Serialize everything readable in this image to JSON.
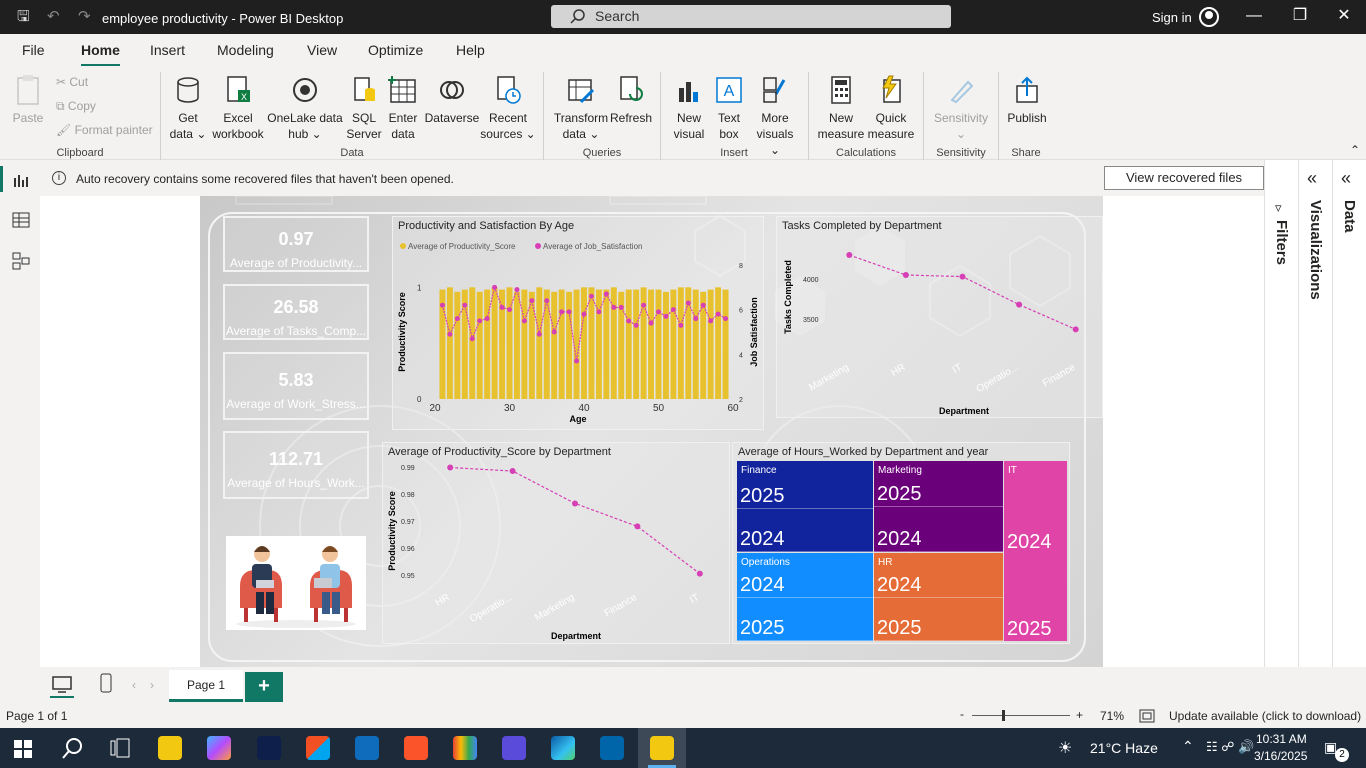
{
  "window": {
    "title": "employee productivity - Power BI Desktop",
    "search_placeholder": "Search",
    "sign_in": "Sign in"
  },
  "menu": [
    "File",
    "Home",
    "Insert",
    "Modeling",
    "View",
    "Optimize",
    "Help"
  ],
  "ribbon": {
    "clipboard": {
      "paste": "Paste",
      "cut": "Cut",
      "copy": "Copy",
      "format_painter": "Format painter",
      "group": "Clipboard"
    },
    "data": {
      "get_data": [
        "Get",
        "data ⌄"
      ],
      "excel": [
        "Excel",
        "workbook"
      ],
      "onelake": [
        "OneLake data",
        "hub ⌄"
      ],
      "sql": [
        "SQL",
        "Server"
      ],
      "enter": [
        "Enter",
        "data"
      ],
      "dataverse": [
        "Dataverse"
      ],
      "recent": [
        "Recent",
        "sources ⌄"
      ],
      "group": "Data"
    },
    "queries": {
      "transform": [
        "Transform",
        "data ⌄"
      ],
      "refresh": [
        "Refresh"
      ],
      "group": "Queries"
    },
    "insert": {
      "new_visual": [
        "New",
        "visual"
      ],
      "text_box": [
        "Text",
        "box"
      ],
      "more_visuals": [
        "More",
        "visuals ⌄"
      ],
      "group": "Insert"
    },
    "calculations": {
      "new_measure": [
        "New",
        "measure"
      ],
      "quick_measure": [
        "Quick",
        "measure"
      ],
      "group": "Calculations"
    },
    "sensitivity": {
      "label": [
        "Sensitivity",
        "⌄"
      ],
      "group": "Sensitivity"
    },
    "share": {
      "publish": [
        "Publish"
      ],
      "group": "Share"
    }
  },
  "infobar": {
    "message": "Auto recovery contains some recovered files that haven't been opened.",
    "button": "View recovered files"
  },
  "panes": {
    "filters": "Filters",
    "visualizations": "Visualizations",
    "data": "Data"
  },
  "cards": [
    {
      "value": "0.97",
      "label": "Average of Productivity..."
    },
    {
      "value": "26.58",
      "label": "Average of Tasks_Comp..."
    },
    {
      "value": "5.83",
      "label": "Average of Work_Stress..."
    },
    {
      "value": "112.71",
      "label": "Average of Hours_Work..."
    }
  ],
  "chart_data": [
    {
      "type": "bar",
      "title": "Productivity and Satisfaction By Age",
      "xlabel": "Age",
      "ylabel": "Productivity Score",
      "y2label": "Job Satisfaction",
      "x": [
        21,
        22,
        23,
        24,
        25,
        26,
        27,
        28,
        29,
        30,
        31,
        32,
        33,
        34,
        35,
        36,
        37,
        38,
        39,
        40,
        41,
        42,
        43,
        44,
        45,
        46,
        47,
        48,
        49,
        50,
        51,
        52,
        53,
        54,
        55,
        56,
        57,
        58,
        59
      ],
      "series": [
        {
          "name": "Average of Productivity_Score",
          "color": "#e8c22e",
          "values": [
            0.98,
            1.0,
            0.96,
            0.98,
            1.0,
            0.96,
            0.98,
            1.0,
            0.98,
            1.0,
            0.96,
            0.98,
            0.96,
            1.0,
            0.98,
            0.96,
            0.98,
            0.96,
            0.98,
            1.0,
            1.0,
            0.98,
            0.98,
            1.0,
            0.96,
            0.98,
            0.98,
            1.0,
            0.98,
            0.98,
            0.96,
            0.98,
            1.0,
            1.0,
            0.98,
            0.96,
            0.98,
            1.0,
            0.98
          ]
        },
        {
          "name": "Average of Job_Satisfaction",
          "color": "#d63fb5",
          "values": [
            6.2,
            4.9,
            5.6,
            6.2,
            4.7,
            5.5,
            5.6,
            7.0,
            6.1,
            6.0,
            6.9,
            5.5,
            6.4,
            4.9,
            6.4,
            5.0,
            5.9,
            5.9,
            3.7,
            5.8,
            6.6,
            5.9,
            6.7,
            6.1,
            6.1,
            5.5,
            5.3,
            6.2,
            5.4,
            5.9,
            5.7,
            6.0,
            5.3,
            6.3,
            5.6,
            6.2,
            5.5,
            5.8,
            5.6
          ]
        }
      ],
      "xticks": [
        "20",
        "30",
        "40",
        "50",
        "60"
      ],
      "yticks": [
        "0",
        "1"
      ],
      "y2ticks": [
        "2",
        "4",
        "6",
        "8"
      ]
    },
    {
      "type": "line",
      "title": "Tasks Completed by Department",
      "xlabel": "Department",
      "ylabel": "Tasks Completed",
      "categories": [
        "Marketing",
        "HR",
        "IT",
        "Operatio...",
        "Finance"
      ],
      "values": [
        4300,
        4050,
        4030,
        3680,
        3370
      ],
      "yticks": [
        "4000",
        "3500"
      ],
      "ylim": [
        3300,
        4400
      ],
      "color": "#d63fb5"
    },
    {
      "type": "line",
      "title": "Average of Productivity_Score by Department",
      "xlabel": "Department",
      "ylabel": "Productivity Score",
      "categories": [
        "HR",
        "Operatio...",
        "Marketing",
        "Finance",
        "IT"
      ],
      "values": [
        0.9898,
        0.9885,
        0.9765,
        0.968,
        0.9505
      ],
      "yticks": [
        "0.99",
        "0.98",
        "0.97",
        "0.96",
        "0.95"
      ],
      "ylim": [
        0.95,
        0.99
      ],
      "color": "#d63fb5"
    }
  ],
  "treemap": {
    "title": "Average of Hours_Worked by Department and year",
    "cells": [
      {
        "group": "Finance",
        "year": "2025",
        "color": "#12239e"
      },
      {
        "group": "",
        "year": "2024",
        "color": "#12239e"
      },
      {
        "group": "Marketing",
        "year": "2025",
        "color": "#6b007b"
      },
      {
        "group": "",
        "year": "2024",
        "color": "#6b007b"
      },
      {
        "group": "IT",
        "year": "2024",
        "color": "#e044a7"
      },
      {
        "group": "",
        "year": "2025",
        "color": "#e044a7"
      },
      {
        "group": "Operations",
        "year": "2024",
        "color": "#118dff"
      },
      {
        "group": "",
        "year": "2025",
        "color": "#118dff"
      },
      {
        "group": "HR",
        "year": "2024",
        "color": "#e66c37"
      },
      {
        "group": "",
        "year": "2025",
        "color": "#e66c37"
      }
    ]
  },
  "pages": {
    "tab": "Page 1",
    "add": "+"
  },
  "status": {
    "page": "Page 1 of 1",
    "zoom": "71%",
    "zoom_minus": "-",
    "zoom_plus": "+",
    "update": "Update available (click to download)"
  },
  "taskbar": {
    "weather": "21°C  Haze",
    "time": "10:31 AM",
    "date": "3/16/2025",
    "notif": "2"
  }
}
